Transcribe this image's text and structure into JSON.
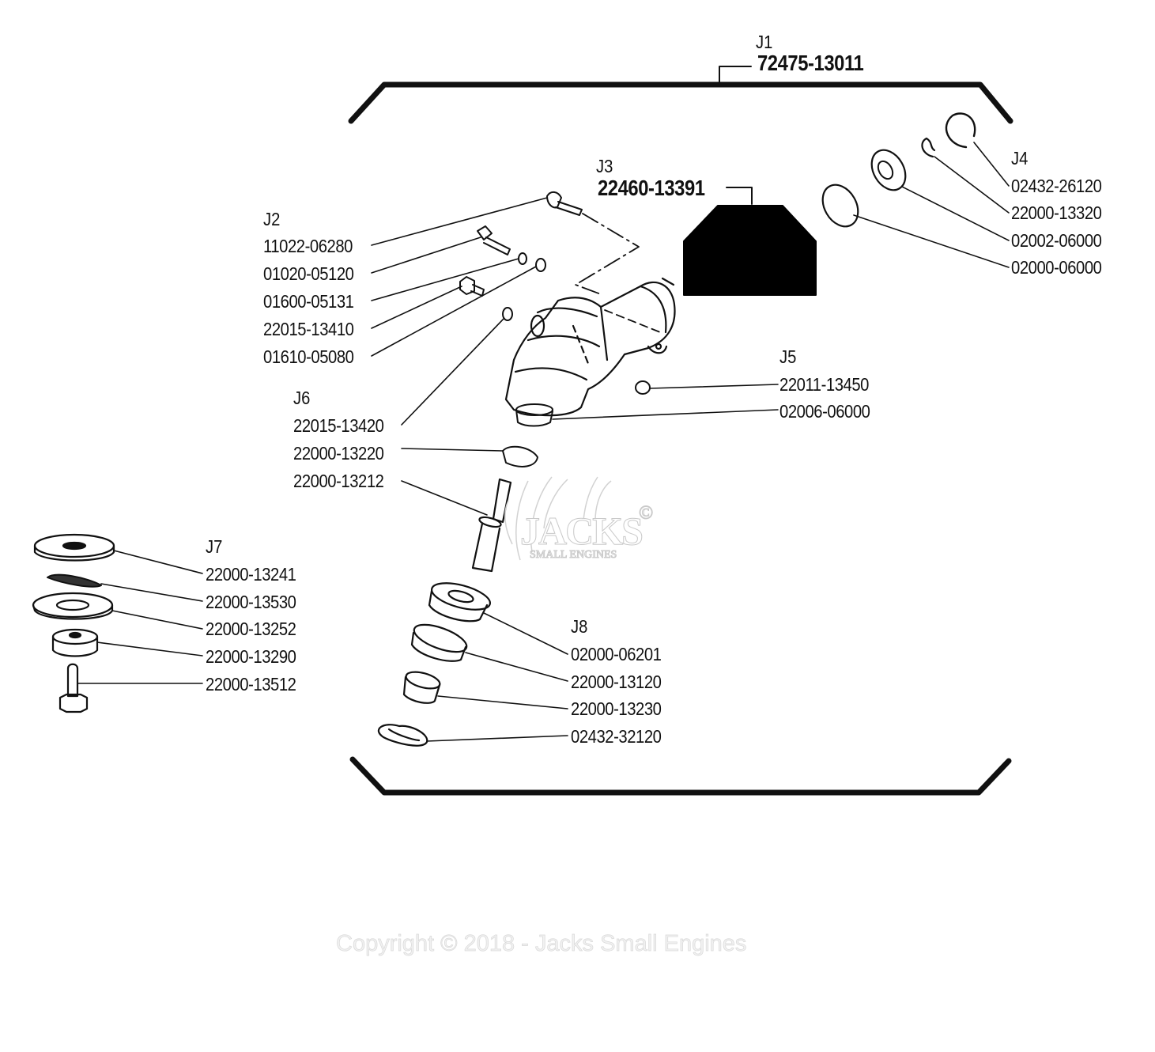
{
  "diagram": {
    "assembly": {
      "id": "J1",
      "part": "72475-13011"
    },
    "groups": [
      {
        "id": "J2",
        "parts": [
          "11022-06280",
          "01020-05120",
          "01600-05131",
          "22015-13410",
          "01610-05080"
        ]
      },
      {
        "id": "J3",
        "parts": [
          "22460-13391"
        ]
      },
      {
        "id": "J4",
        "parts": [
          "02432-26120",
          "22000-13320",
          "02002-06000",
          "02000-06000"
        ]
      },
      {
        "id": "J5",
        "parts": [
          "22011-13450",
          "02006-06000"
        ]
      },
      {
        "id": "J6",
        "parts": [
          "22015-13420",
          "22000-13220",
          "22000-13212"
        ]
      },
      {
        "id": "J7",
        "parts": [
          "22000-13241",
          "22000-13530",
          "22000-13252",
          "22000-13290",
          "22000-13512"
        ]
      },
      {
        "id": "J8",
        "parts": [
          "02000-06201",
          "22000-13120",
          "22000-13230",
          "02432-32120"
        ]
      }
    ]
  },
  "watermark": {
    "brand": "JACKS",
    "tagline": "SMALL ENGINES",
    "mark": "©"
  },
  "footer": {
    "copyright": "Copyright © 2018 - Jacks Small Engines"
  },
  "colors": {
    "ink": "#111111",
    "watermark": "#c9c9c9",
    "background": "#ffffff"
  }
}
